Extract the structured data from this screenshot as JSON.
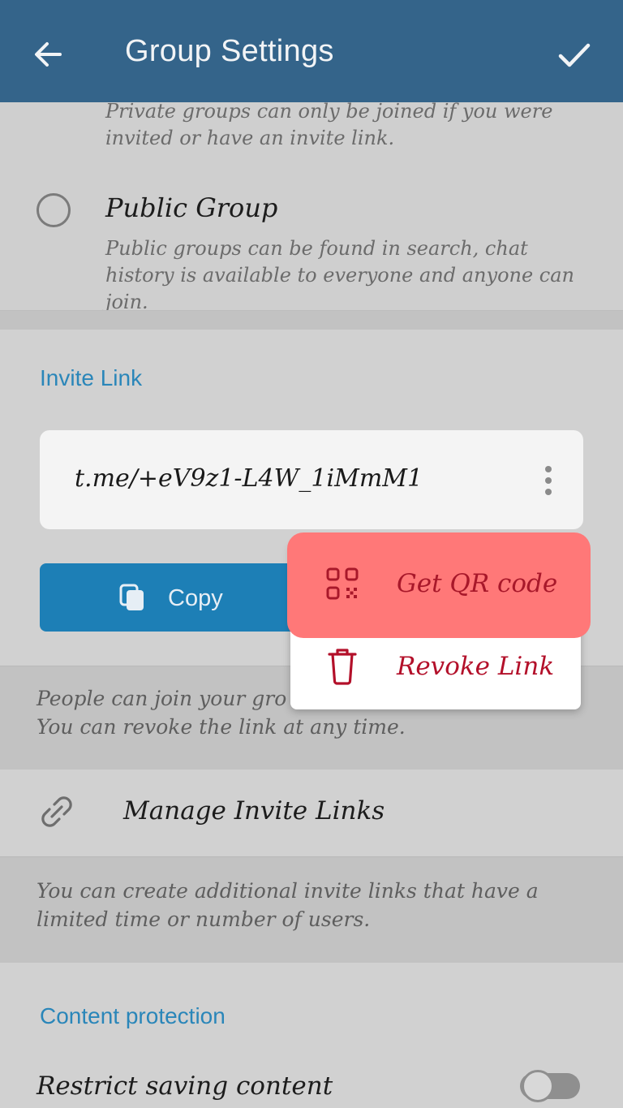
{
  "appbar": {
    "title": "Group Settings",
    "back_icon": "arrow-left-icon",
    "done_icon": "checkmark-icon",
    "color": "#34648a"
  },
  "group_type": {
    "private_description": "Private groups can only be joined if you were invited or have an invite link.",
    "public_title": "Public Group",
    "public_description": "Public groups can be found in search, chat history is available to everyone and anyone can join.",
    "public_selected": false
  },
  "invite": {
    "header": "Invite Link",
    "link": "t.me/+eV9z1-L4W_1iMmM1",
    "copy_label": "Copy",
    "info": "People can join your gro",
    "info_line2": "You can revoke the link at any time."
  },
  "context_menu": {
    "items": [
      {
        "label": "Get QR code",
        "icon": "qr-code-icon",
        "highlighted": true
      },
      {
        "label": "Revoke Link",
        "icon": "trash-icon",
        "highlighted": false
      }
    ],
    "highlight_color": "#ff7878"
  },
  "manage": {
    "label": "Manage Invite Links",
    "icon": "link-icon",
    "info": "You can create additional invite links that have a limited time or number of users."
  },
  "content_protection": {
    "header": "Content protection",
    "restrict_label": "Restrict saving content",
    "restrict_enabled": false
  },
  "accent_color": "#2a86b9"
}
